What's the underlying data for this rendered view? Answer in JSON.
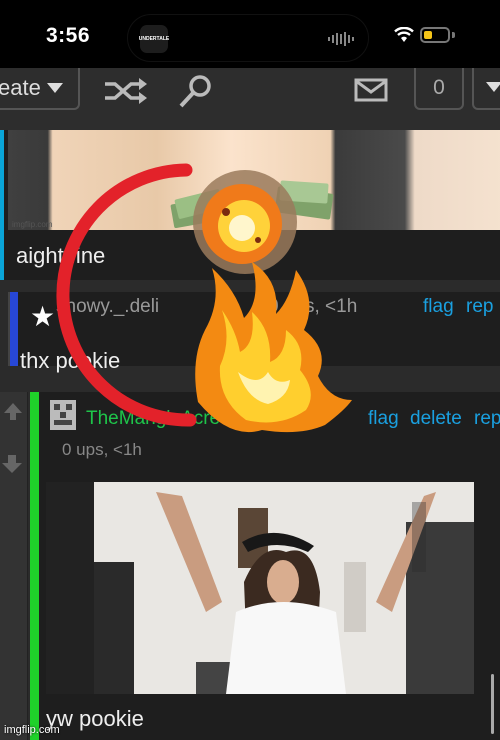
{
  "status_bar": {
    "time": "3:56",
    "island_app": "UNDERTALE"
  },
  "toolbar": {
    "sort_label": "eate",
    "notification_count": "0"
  },
  "comments": [
    {
      "text": "aight fine",
      "image_watermark": "imgflip.com"
    },
    {
      "username": "snowy._.deli",
      "meta": "0 ups, <1h",
      "flag": "flag",
      "reply": "rep",
      "text": "thx pookie"
    },
    {
      "username": "TheMangleAcre",
      "meta": "0 ups, <1h",
      "flag": "flag",
      "delete": "delete",
      "reply": "rep",
      "text": "yw pookie",
      "image_watermark": "imgflip.com"
    }
  ],
  "footer_watermark": "imgflip.com",
  "colors": {
    "accent_blue": "#1aa0e0",
    "comment_green": "#1fd12a",
    "reply_blue": "#2747d6",
    "red_circle": "#e3222a"
  },
  "icons": [
    "shuffle-icon",
    "search-icon",
    "mail-icon",
    "star-icon",
    "wifi-icon",
    "battery-icon"
  ]
}
